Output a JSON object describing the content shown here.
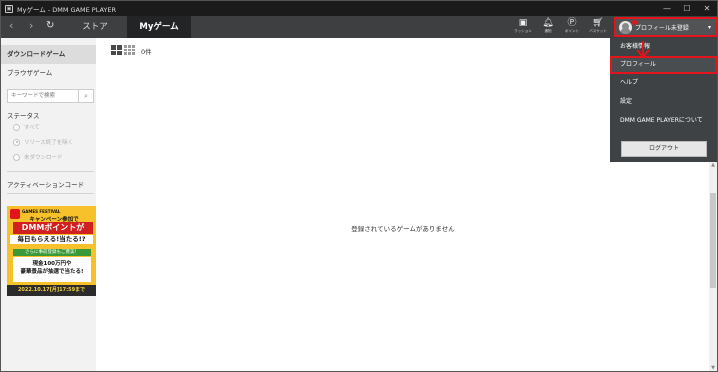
{
  "window": {
    "title": "Myゲーム - DMM GAME PLAYER",
    "minimize": "—",
    "maximize": "☐",
    "close": "✕"
  },
  "nav": {
    "back": "‹",
    "forward": "›",
    "reload": "↻",
    "tabs": [
      {
        "label": "ストア",
        "active": false
      },
      {
        "label": "Myゲーム",
        "active": true
      }
    ],
    "icons": [
      {
        "name": "cushion-icon",
        "caption": "クッション"
      },
      {
        "name": "bell-icon",
        "caption": "通知"
      },
      {
        "name": "point-icon",
        "caption": "ポイント"
      },
      {
        "name": "basket-icon",
        "caption": "バスケット"
      }
    ],
    "profile_label": "プロフィール未登録",
    "profile_caret": "▾"
  },
  "sidebar": {
    "items": [
      "ダウンロードゲーム",
      "ブラウザゲーム"
    ],
    "search_placeholder": "キーワードで検索",
    "search_icon": "⌕",
    "status_label": "ステータス",
    "status_options": [
      {
        "label": "すべて",
        "checked": false
      },
      {
        "label": "リリース終了を除く",
        "checked": true
      },
      {
        "label": "未ダウンロード",
        "checked": false
      }
    ],
    "activation_code": "アクティベーションコード"
  },
  "banner": {
    "line1": "GAMES FESTIVAL",
    "line2": "キャンペーン参加で",
    "line3": "DMMポイントが",
    "line4": "毎日もらえる!当たる!?",
    "line5": "さらに事前登録もご褒美！",
    "line6a": "現金100万円や",
    "line6b": "豪華景品が抽選で当たる!",
    "line7": "2022.10.17[月]17:59まで"
  },
  "main": {
    "count": "0件",
    "empty_message": "登録されているゲームがありません"
  },
  "dropdown": {
    "items": [
      "お客様情報",
      "プロフィール",
      "ヘルプ",
      "設定",
      "DMM GAME PLAYERについて"
    ],
    "logout": "ログアウト"
  },
  "colors": {
    "highlight_red": "#e3141b",
    "nav_bg": "#3d3f41",
    "dropdown_bg": "#3f4244"
  }
}
